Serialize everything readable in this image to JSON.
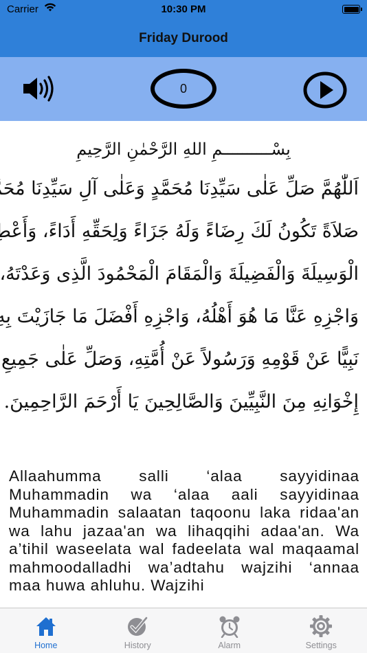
{
  "status_bar": {
    "carrier": "Carrier",
    "time": "10:30 PM"
  },
  "header": {
    "title": "Friday Durood"
  },
  "controls": {
    "counter_value": "0",
    "speaker_icon": "speaker-volume-icon",
    "play_icon": "play-circle-icon"
  },
  "arabic": {
    "basmala": "بِسْــــــــــمِ اللهِ الرَّحْمٰنِ الرَّحِيمِ",
    "lines": [
      "اَللّٰهُمَّ صَلِّ عَلٰى سَيِّدِنَا مُحَمَّدٍ وَعَلٰى آلِ سَيِّدِنَا مُحَمَّدٍ",
      "صَلاَةً تَكُونُ لَكَ رِضَاءً وَلَهُ جَزَاءً وَلِحَقِّهِ أَدَاءً، وَأَعْطِهِ",
      "الْوَسِيلَةَ وَالْفَضِيلَةَ وَالْمَقَامَ الْمَحْمُودَ الَّذِى وَعَدْتَهُ،",
      "وَاجْزِهِ عَنَّا مَا هُوَ أَهْلُهُ، وَاجْزِهِ أَفْضَلَ مَا جَازَيْتَ بِهِ",
      "نَبِيًّا عَنْ قَوْمِهِ وَرَسُولاً عَنْ أُمَّتِهِ، وَصَلِّ عَلٰى جَمِيعِ",
      "إِخْوَانِهِ مِنَ النَّبِيِّينَ وَالصَّالِحِينَ يَا أَرْحَمَ الرَّاحِمِينَ."
    ]
  },
  "transliteration": "Allaahumma salli ‘alaa sayyidinaa Muhammadin wa ‘alaa aali sayyidinaa Muhammadin salaatan taqoonu laka ridaa'an wa lahu jazaa'an wa lihaqqihi adaa'an. Wa a’tihil waseelata wal fadeelata wal maqaamal mahmoodalladhi wa’adtahu wajzihi ‘annaa maa huwa ahluhu. Wajzihi",
  "tabs": [
    {
      "label": "Home",
      "icon": "home-icon",
      "active": true
    },
    {
      "label": "History",
      "icon": "checkmark-circle-icon",
      "active": false
    },
    {
      "label": "Alarm",
      "icon": "alarm-clock-icon",
      "active": false
    },
    {
      "label": "Settings",
      "icon": "gear-icon",
      "active": false
    }
  ],
  "colors": {
    "header_blue": "#2f80d9",
    "controls_blue": "#86b0f0",
    "tab_active": "#1f6fd0",
    "tab_inactive": "#8e8e93"
  }
}
